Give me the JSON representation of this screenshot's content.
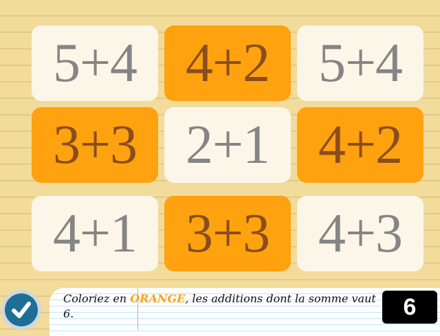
{
  "tiles": [
    {
      "label": "5+4",
      "colored": false
    },
    {
      "label": "4+2",
      "colored": true
    },
    {
      "label": "5+4",
      "colored": false
    },
    {
      "label": "3+3",
      "colored": true
    },
    {
      "label": "2+1",
      "colored": false
    },
    {
      "label": "4+2",
      "colored": true
    },
    {
      "label": "4+1",
      "colored": false
    },
    {
      "label": "3+3",
      "colored": true
    },
    {
      "label": "4+3",
      "colored": false
    }
  ],
  "instruction": {
    "prefix": "Coloriez en ",
    "color_word": "ORANGE",
    "suffix": ", les additions dont la somme vaut 6."
  },
  "target_sum": "6",
  "colors": {
    "orange": "#ffa20f",
    "tile_white": "#fbf6e8",
    "check_blue": "#1e6f96"
  },
  "icons": {
    "check_button": "checkmark-icon"
  }
}
